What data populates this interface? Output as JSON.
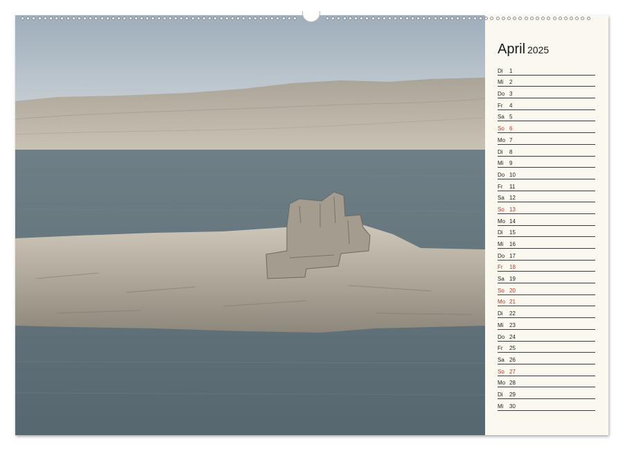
{
  "calendar": {
    "month": "April",
    "year": "2025",
    "accent_color": "#c0392b",
    "days": [
      {
        "wd": "Di",
        "d": "1",
        "red": false
      },
      {
        "wd": "Mi",
        "d": "2",
        "red": false
      },
      {
        "wd": "Do",
        "d": "3",
        "red": false
      },
      {
        "wd": "Fr",
        "d": "4",
        "red": false
      },
      {
        "wd": "Sa",
        "d": "5",
        "red": false
      },
      {
        "wd": "So",
        "d": "6",
        "red": true
      },
      {
        "wd": "Mo",
        "d": "7",
        "red": false
      },
      {
        "wd": "Di",
        "d": "8",
        "red": false
      },
      {
        "wd": "Mi",
        "d": "9",
        "red": false
      },
      {
        "wd": "Do",
        "d": "10",
        "red": false
      },
      {
        "wd": "Fr",
        "d": "11",
        "red": false
      },
      {
        "wd": "Sa",
        "d": "12",
        "red": false
      },
      {
        "wd": "So",
        "d": "13",
        "red": true
      },
      {
        "wd": "Mo",
        "d": "14",
        "red": false
      },
      {
        "wd": "Di",
        "d": "15",
        "red": false
      },
      {
        "wd": "Mi",
        "d": "16",
        "red": false
      },
      {
        "wd": "Do",
        "d": "17",
        "red": false
      },
      {
        "wd": "Fr",
        "d": "18",
        "red": true
      },
      {
        "wd": "Sa",
        "d": "19",
        "red": false
      },
      {
        "wd": "So",
        "d": "20",
        "red": true
      },
      {
        "wd": "Mo",
        "d": "21",
        "red": true
      },
      {
        "wd": "Di",
        "d": "22",
        "red": false
      },
      {
        "wd": "Mi",
        "d": "23",
        "red": false
      },
      {
        "wd": "Do",
        "d": "24",
        "red": false
      },
      {
        "wd": "Fr",
        "d": "25",
        "red": false
      },
      {
        "wd": "Sa",
        "d": "26",
        "red": false
      },
      {
        "wd": "So",
        "d": "27",
        "red": true
      },
      {
        "wd": "Mo",
        "d": "28",
        "red": false
      },
      {
        "wd": "Di",
        "d": "29",
        "red": false
      },
      {
        "wd": "Mi",
        "d": "30",
        "red": false
      }
    ]
  },
  "photo": {
    "sky_color": "#b7c3cc",
    "hills_color": "#bab3a6",
    "sea_color": "#5f7179",
    "island_color": "#c4bdb0"
  }
}
